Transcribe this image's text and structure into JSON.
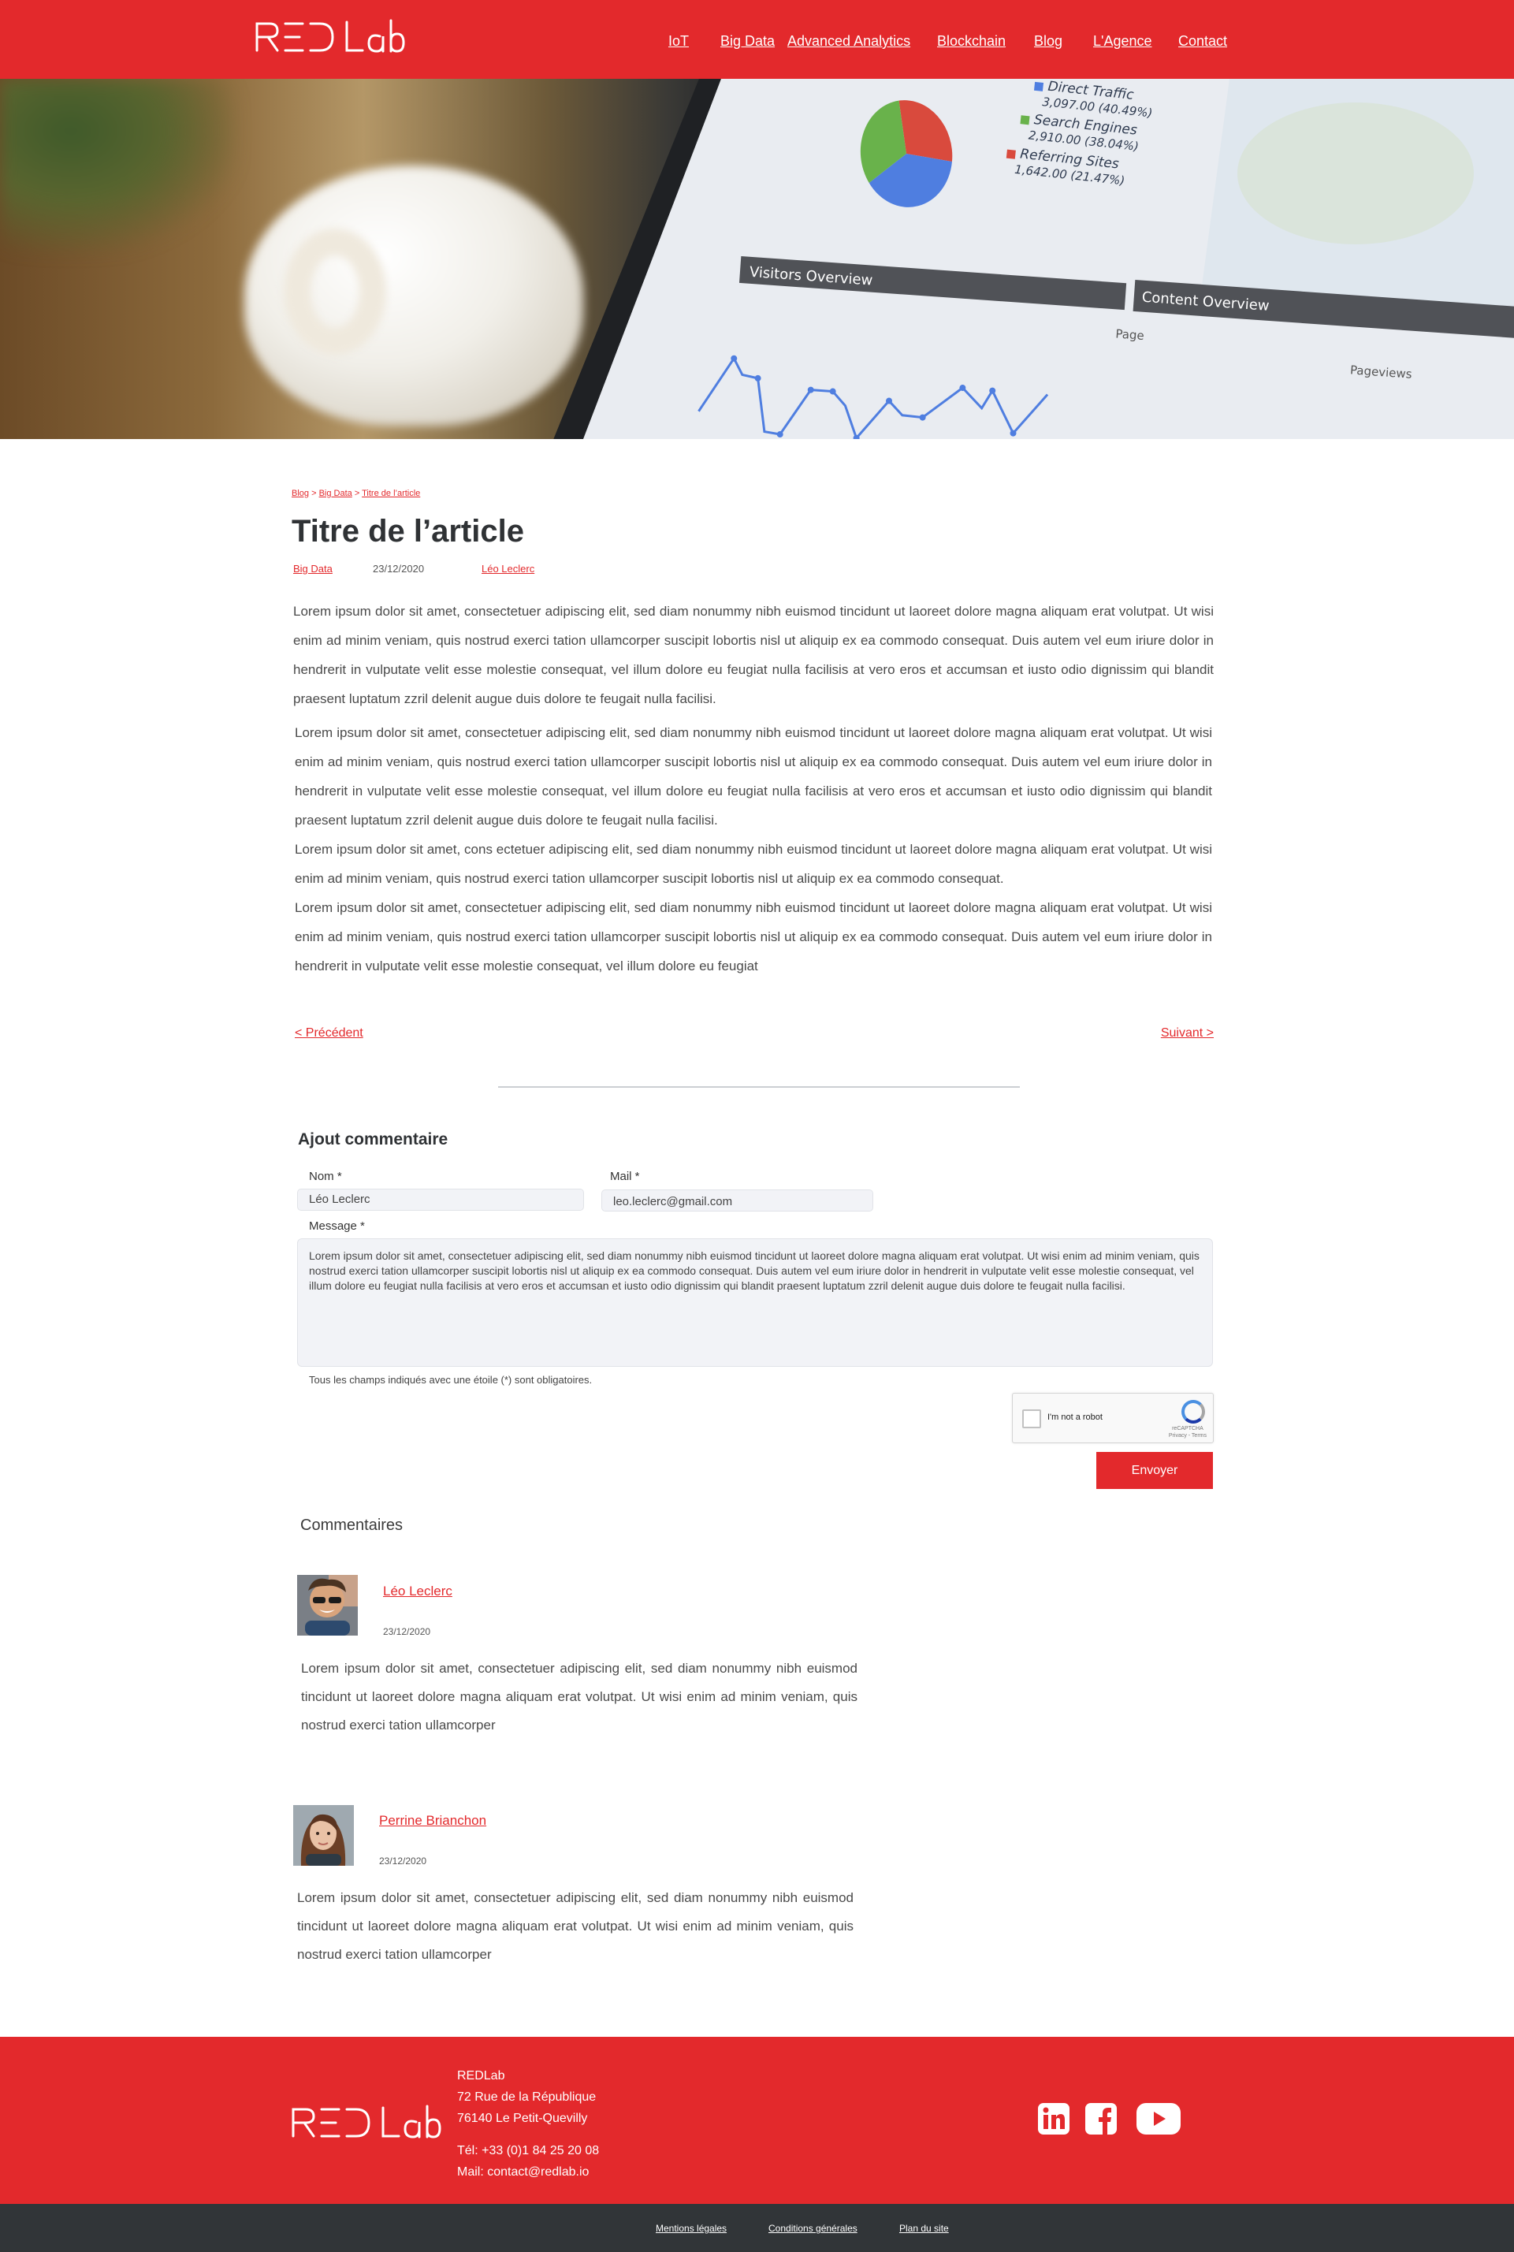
{
  "brand": {
    "name": "RED Lab",
    "accent": "#e3292c",
    "footer_dark": "#313538"
  },
  "nav": {
    "items": [
      {
        "label": "IoT"
      },
      {
        "label": "Big Data"
      },
      {
        "label": "Advanced Analytics"
      },
      {
        "label": "Blockchain"
      },
      {
        "label": "Blog"
      },
      {
        "label": "L'Agence"
      },
      {
        "label": "Contact"
      }
    ]
  },
  "hero": {
    "legend": [
      {
        "label": "Direct Traffic",
        "value": "3,097.00 (40.49%)",
        "color": "#4f7ee0"
      },
      {
        "label": "Search Engines",
        "value": "2,910.00 (38.04%)",
        "color": "#69b24b"
      },
      {
        "label": "Referring Sites",
        "value": "1,642.00 (21.47%)",
        "color": "#d94a3d"
      }
    ],
    "visitors_label": "Visitors Overview",
    "content_label": "Content Overview",
    "page_label": "Page",
    "pageviews_label": "Pageviews"
  },
  "article": {
    "breadcrumb": {
      "blog": "Blog",
      "sep": " > ",
      "category": "Big Data",
      "current": "Titre de l’article"
    },
    "title": "Titre de l’article",
    "category": "Big Data",
    "date": "23/12/2020",
    "author": "Léo Leclerc",
    "paragraphs": [
      "Lorem ipsum dolor sit amet, consectetuer adipiscing elit, sed diam nonummy nibh euismod tincidunt ut laoreet dolore magna aliquam erat volutpat. Ut wisi enim ad minim veniam, quis nostrud exerci tation ullamcorper suscipit lobortis nisl ut aliquip ex ea commodo consequat. Duis autem vel eum iriure dolor in hendrerit in vulputate velit esse molestie consequat, vel illum dolore eu feugiat nulla facilisis at vero eros et accumsan et iusto odio dignissim qui blandit praesent luptatum zzril delenit augue duis dolore te feugait nulla facilisi.",
      "Lorem ipsum dolor sit amet, consectetuer adipiscing elit, sed diam nonummy nibh euismod tincidunt ut laoreet dolore magna aliquam erat volutpat. Ut wisi enim ad minim veniam, quis nostrud exerci tation ullamcorper suscipit lobortis nisl ut aliquip ex ea commodo consequat. Duis autem vel eum iriure dolor in hendrerit in vulputate velit esse molestie consequat, vel illum dolore eu feugiat nulla facilisis at vero eros et accumsan et iusto odio dignissim qui blandit praesent luptatum zzril delenit augue duis dolore te feugait nulla facilisi.",
      "Lorem ipsum dolor sit amet, cons ectetuer adipiscing elit, sed diam nonummy nibh euismod tincidunt ut laoreet dolore magna aliquam erat volutpat. Ut wisi enim ad minim veniam, quis nostrud exerci tation ullamcorper suscipit lobortis nisl ut aliquip ex ea commodo consequat.",
      "Lorem ipsum dolor sit amet, consectetuer adipiscing elit, sed diam nonummy nibh euismod tincidunt ut laoreet dolore magna aliquam erat volutpat. Ut wisi enim ad minim veniam, quis nostrud exerci tation ullamcorper suscipit lobortis nisl ut aliquip ex ea commodo consequat. Duis autem vel eum iriure dolor in hendrerit in vulputate velit esse molestie consequat, vel illum dolore eu feugiat"
    ],
    "prev_label": "<    Précédent",
    "next_label": "Suivant    >"
  },
  "comment_form": {
    "title": "Ajout commentaire",
    "name_label": "Nom *",
    "name_value": "Léo Leclerc",
    "mail_label": "Mail *",
    "mail_value": "leo.leclerc@gmail.com",
    "message_label": "Message *",
    "message_value": "Lorem ipsum dolor sit amet, consectetuer adipiscing elit, sed diam nonummy nibh euismod tincidunt ut laoreet dolore magna aliquam erat volutpat. Ut wisi enim ad minim veniam, quis nostrud exerci tation ullamcorper suscipit lobortis nisl ut aliquip ex ea commodo consequat. Duis autem vel eum iriure dolor in hendrerit in vulputate velit esse molestie consequat, vel illum dolore eu feugiat nulla facilisis at vero eros et accumsan et iusto odio dignissim qui blandit praesent luptatum zzril delenit augue duis dolore te feugait nulla facilisi.",
    "required_note": "Tous les champs indiqués avec une étoile (*) sont obligatoires.",
    "captcha_label": "I'm not a robot",
    "captcha_brand": "reCAPTCHA",
    "captcha_links": "Privacy - Terms",
    "submit_label": "Envoyer"
  },
  "comments": {
    "title": "Commentaires",
    "items": [
      {
        "author": "Léo Leclerc",
        "date": "23/12/2020",
        "avatar": "man-sunglasses-avatar",
        "text": "Lorem ipsum dolor sit amet, consectetuer adipiscing elit, sed diam nonummy nibh euismod tincidunt ut laoreet dolore magna aliquam erat volutpat. Ut wisi enim ad minim veniam, quis nostrud exerci tation ullamcorper"
      },
      {
        "author": "Perrine Brianchon",
        "date": "23/12/2020",
        "avatar": "woman-avatar",
        "text": "Lorem ipsum dolor sit amet, consectetuer adipiscing elit, sed diam nonummy nibh euismod tincidunt ut laoreet dolore magna aliquam erat volutpat. Ut wisi enim ad minim veniam, quis nostrud exerci tation ullamcorper"
      }
    ]
  },
  "footer": {
    "company": "REDLab",
    "street": "72 Rue de la République",
    "city": "76140 Le Petit-Quevilly",
    "phone": "Tél: +33 (0)1 84 25 20 08",
    "mail": "Mail: contact@redlab.io",
    "social": [
      "linkedin-icon",
      "facebook-icon",
      "youtube-icon"
    ],
    "links": [
      "Mentions légales",
      "Conditions générales",
      "Plan du site"
    ]
  }
}
